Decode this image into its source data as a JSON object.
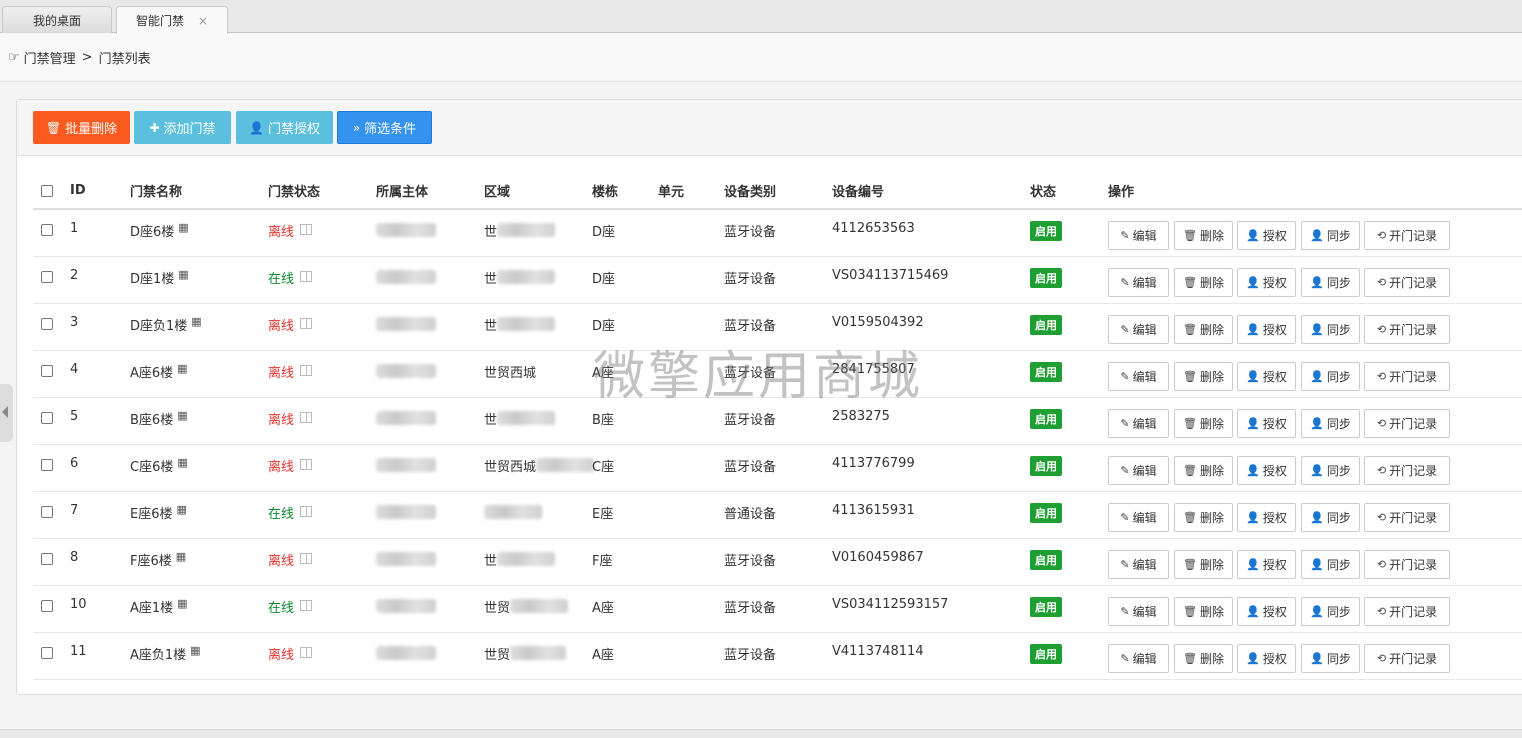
{
  "tabs": [
    {
      "label": "我的桌面",
      "active": false
    },
    {
      "label": "智能门禁",
      "active": true,
      "close": "×"
    }
  ],
  "breadcrumb": {
    "icon": "pointing-hand-icon",
    "hand": "☞",
    "items": [
      "门禁管理",
      "门禁列表"
    ],
    "separator": ">"
  },
  "toolbar": {
    "batch_delete": "批量删除",
    "add": "添加门禁",
    "authorize": "门禁授权",
    "filter": "筛选条件"
  },
  "table": {
    "headers": [
      "ID",
      "门禁名称",
      "门禁状态",
      "所属主体",
      "区域",
      "楼栋",
      "单元",
      "设备类别",
      "设备编号",
      "状态",
      "操作"
    ],
    "rows": [
      {
        "id": "1",
        "name": "D座6楼",
        "state": "离线",
        "area_prefix": "世",
        "building": "D座",
        "unit": "",
        "type": "蓝牙设备",
        "device_no": "4112653563",
        "status": "启用"
      },
      {
        "id": "2",
        "name": "D座1楼",
        "state": "在线",
        "area_prefix": "世",
        "building": "D座",
        "unit": "",
        "type": "蓝牙设备",
        "device_no": "VS034113715469",
        "status": "启用"
      },
      {
        "id": "3",
        "name": "D座负1楼",
        "state": "离线",
        "area_prefix": "世",
        "building": "D座",
        "unit": "",
        "type": "蓝牙设备",
        "device_no": "V0159504392",
        "status": "启用"
      },
      {
        "id": "4",
        "name": "A座6楼",
        "state": "离线",
        "area_prefix": "世贸西城",
        "building": "A座",
        "unit": "",
        "type": "蓝牙设备",
        "device_no": "2841755807",
        "status": "启用"
      },
      {
        "id": "5",
        "name": "B座6楼",
        "state": "离线",
        "area_prefix": "世",
        "building": "B座",
        "unit": "",
        "type": "蓝牙设备",
        "device_no": "2583275",
        "status": "启用"
      },
      {
        "id": "6",
        "name": "C座6楼",
        "state": "离线",
        "area_prefix": "世贸西城",
        "building": "C座",
        "unit": "",
        "type": "蓝牙设备",
        "device_no": "4113776799",
        "status": "启用"
      },
      {
        "id": "7",
        "name": "E座6楼",
        "state": "在线",
        "area_prefix": "",
        "building": "E座",
        "unit": "",
        "type": "普通设备",
        "device_no": "4113615931",
        "status": "启用"
      },
      {
        "id": "8",
        "name": "F座6楼",
        "state": "离线",
        "area_prefix": "世",
        "building": "F座",
        "unit": "",
        "type": "蓝牙设备",
        "device_no": "V0160459867",
        "status": "启用"
      },
      {
        "id": "10",
        "name": "A座1楼",
        "state": "在线",
        "area_prefix": "世贸",
        "building": "A座",
        "unit": "",
        "type": "蓝牙设备",
        "device_no": "VS034112593157",
        "status": "启用"
      },
      {
        "id": "11",
        "name": "A座负1楼",
        "state": "离线",
        "area_prefix": "世贸",
        "building": "A座",
        "unit": "",
        "type": "蓝牙设备",
        "device_no": "V4113748114",
        "status": "启用"
      }
    ],
    "ops": {
      "edit": "编辑",
      "delete": "删除",
      "authorize": "授权",
      "sync": "同步",
      "records": "开门记录"
    }
  },
  "icons": {
    "qr": "qrcode-icon",
    "doc": "document-icon",
    "trash": "trash-icon",
    "plus": "plus-icon",
    "user": "user-icon",
    "filter": "chevron-double-down-icon",
    "edit": "edit-icon",
    "sync": "sync-icon"
  },
  "watermark": "微擎应用商城",
  "colors": {
    "online": "#0e8a2e",
    "offline": "#e5332b",
    "badge": "#1f9e33",
    "danger_button": "#fc5a1e",
    "info_button": "#5bc0de",
    "primary_button": "#3393ef"
  }
}
